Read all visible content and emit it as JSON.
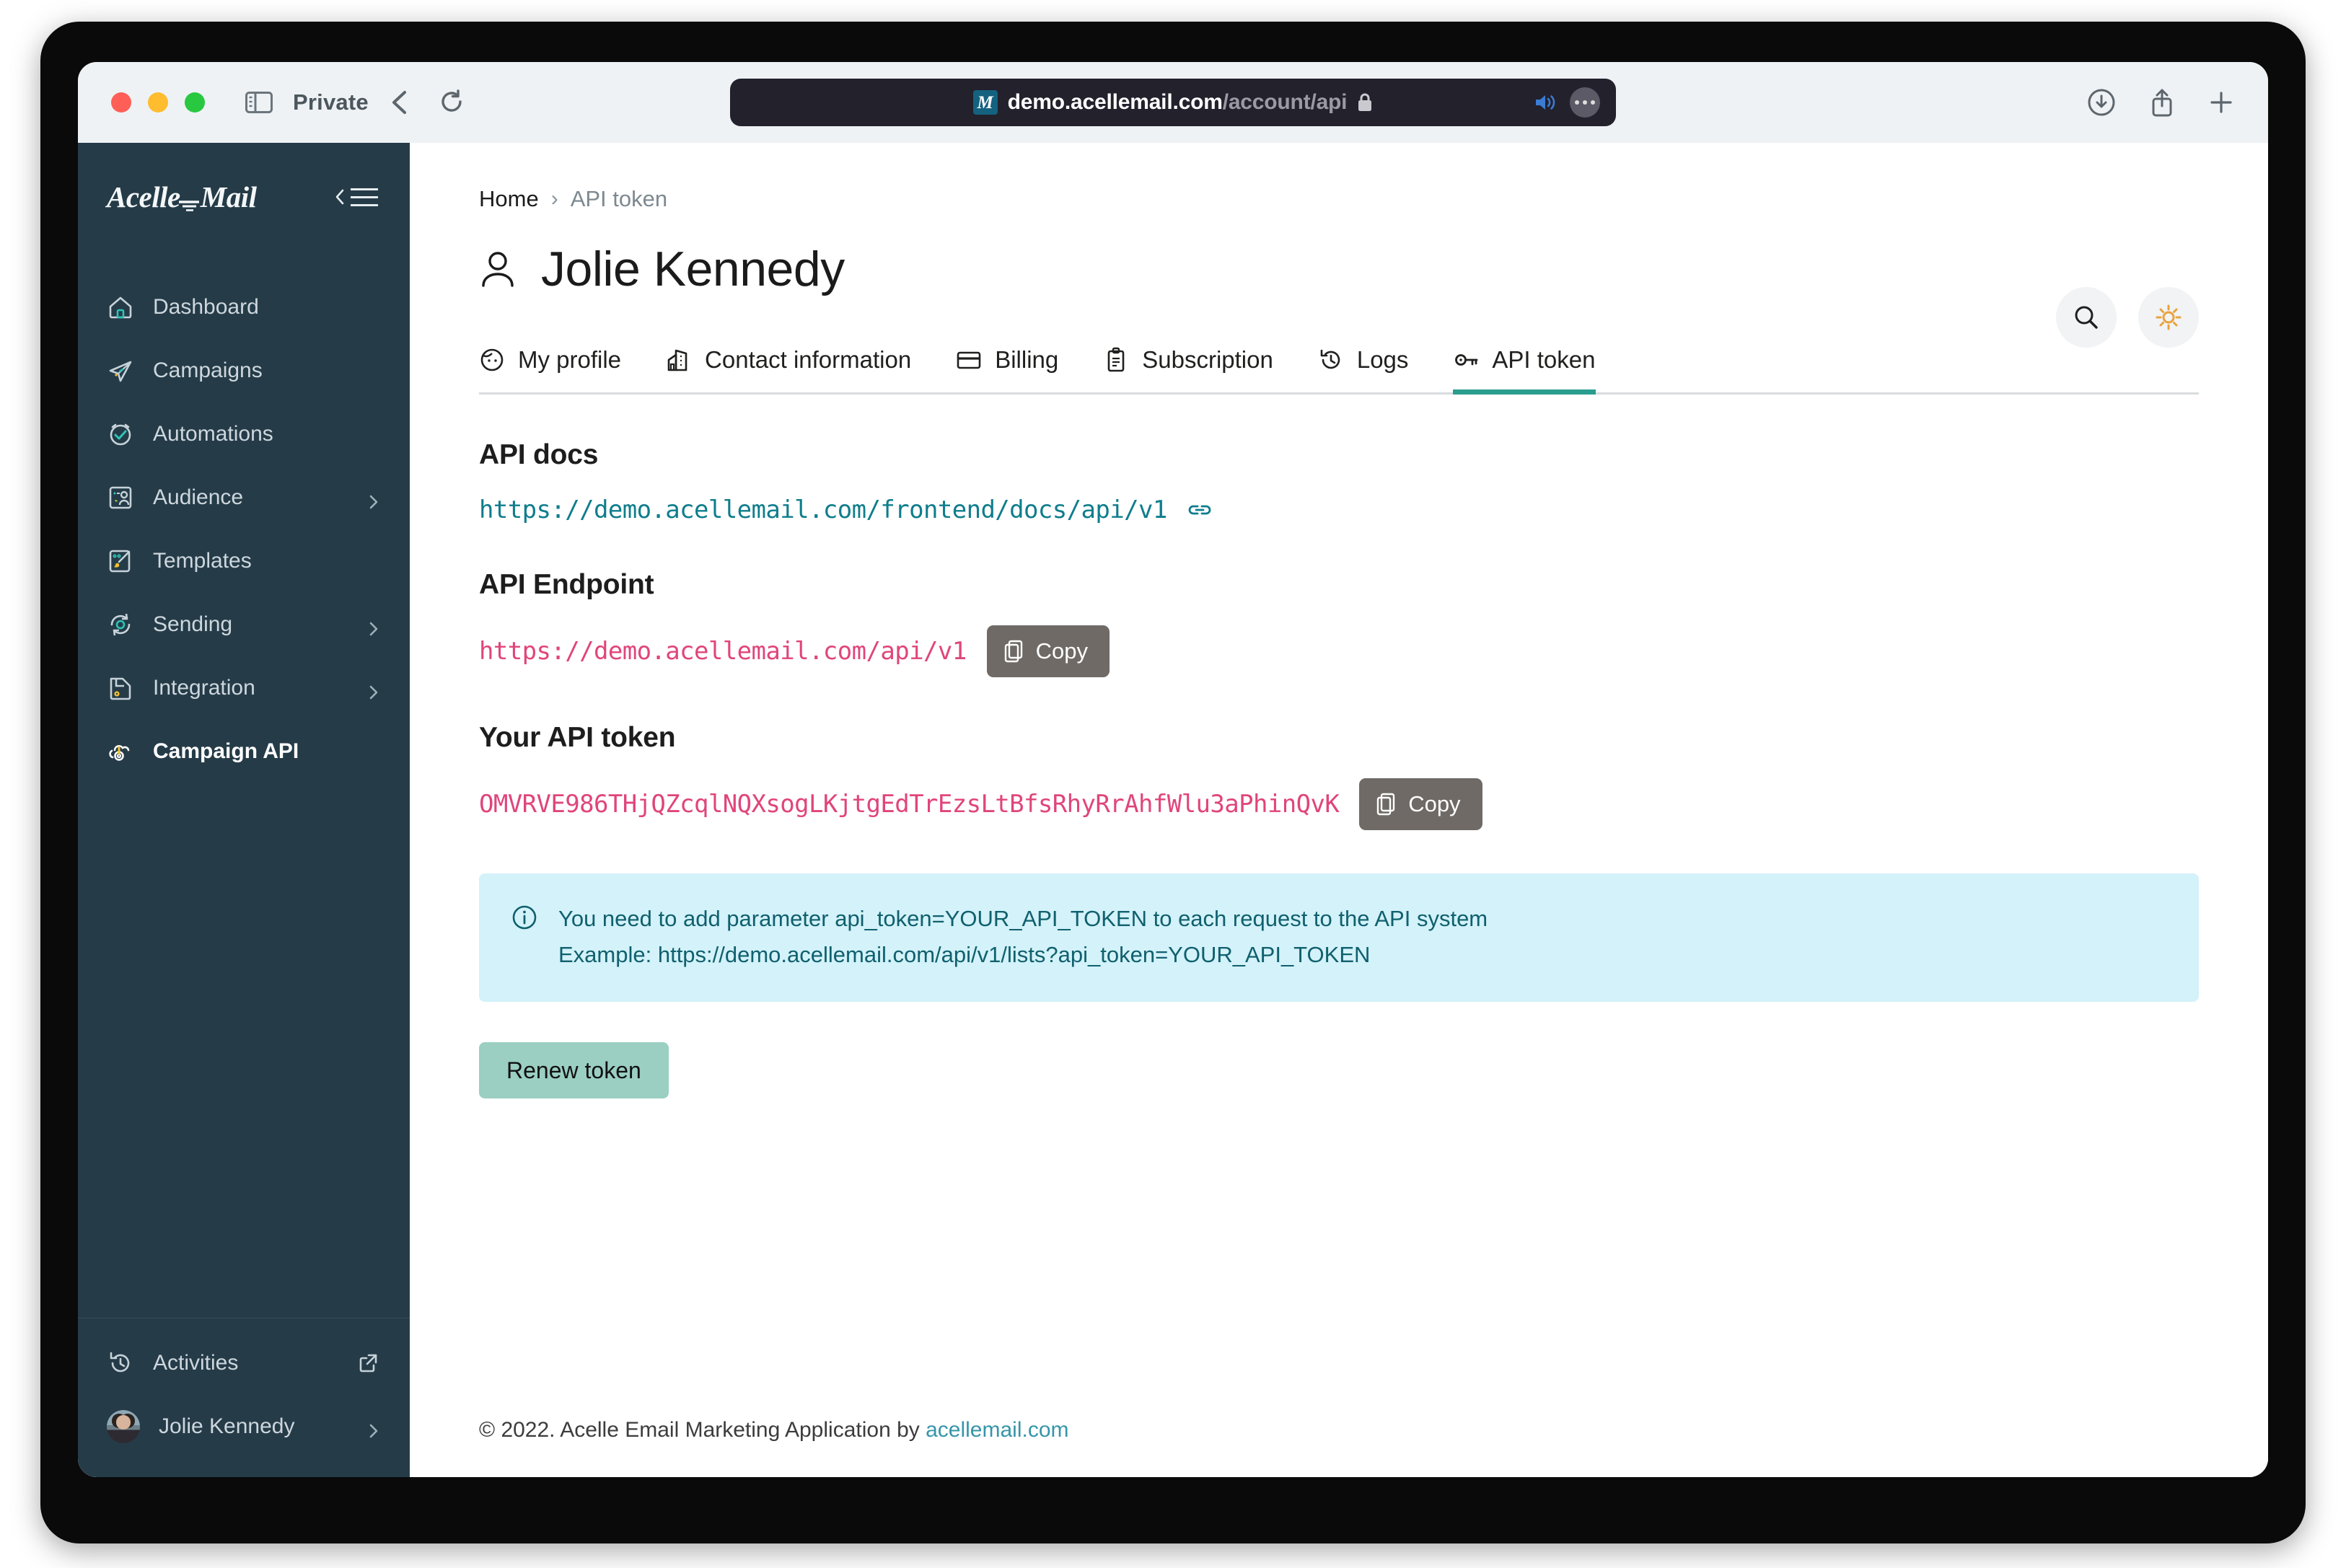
{
  "browser": {
    "private_label": "Private",
    "url_domain": "demo.acellemail.com",
    "url_path": "/account/api",
    "favicon_letter": "M"
  },
  "sidebar": {
    "brand_left": "Acelle",
    "brand_right": "Mail",
    "items": [
      {
        "label": "Dashboard",
        "icon": "home-icon",
        "chevron": false,
        "active": false
      },
      {
        "label": "Campaigns",
        "icon": "paper-plane-icon",
        "chevron": false,
        "active": false
      },
      {
        "label": "Automations",
        "icon": "check-circle-icon",
        "chevron": false,
        "active": false
      },
      {
        "label": "Audience",
        "icon": "contact-card-icon",
        "chevron": true,
        "active": false
      },
      {
        "label": "Templates",
        "icon": "brush-icon",
        "chevron": false,
        "active": false
      },
      {
        "label": "Sending",
        "icon": "sync-gear-icon",
        "chevron": true,
        "active": false
      },
      {
        "label": "Integration",
        "icon": "plug-save-icon",
        "chevron": true,
        "active": false
      },
      {
        "label": "Campaign API",
        "icon": "cloud-gear-icon",
        "chevron": false,
        "active": true
      }
    ],
    "bottom": {
      "activities_label": "Activities",
      "user_label": "Jolie Kennedy"
    }
  },
  "breadcrumb": {
    "home": "Home",
    "separator": "›",
    "current": "API token"
  },
  "header": {
    "title": "Jolie Kennedy"
  },
  "tabs": [
    {
      "label": "My profile",
      "icon": "face-icon",
      "active": false
    },
    {
      "label": "Contact information",
      "icon": "building-icon",
      "active": false
    },
    {
      "label": "Billing",
      "icon": "card-icon",
      "active": false
    },
    {
      "label": "Subscription",
      "icon": "clipboard-icon",
      "active": false
    },
    {
      "label": "Logs",
      "icon": "history-icon",
      "active": false
    },
    {
      "label": "API token",
      "icon": "key-icon",
      "active": true
    }
  ],
  "sections": {
    "api_docs": {
      "heading": "API docs",
      "url": "https://demo.acellemail.com/frontend/docs/api/v1"
    },
    "api_endpoint": {
      "heading": "API Endpoint",
      "url": "https://demo.acellemail.com/api/v1",
      "copy_label": "Copy"
    },
    "api_token": {
      "heading": "Your API token",
      "value": "OMVRVE986THjQZcqlNQXsogLKjtgEdTrEzsLtBfsRhyRrAhfWlu3aPhinQvK",
      "copy_label": "Copy"
    }
  },
  "alert": {
    "line1": "You need to add parameter api_token=YOUR_API_TOKEN to each request to the API system",
    "line2": "Example: https://demo.acellemail.com/api/v1/lists?api_token=YOUR_API_TOKEN"
  },
  "renew_button": {
    "label": "Renew token"
  },
  "footer": {
    "text": "© 2022. Acelle Email Marketing Application by ",
    "link": "acellemail.com"
  },
  "colors": {
    "sidebar_bg": "#253b48",
    "accent_teal": "#2a9d8f",
    "code_pink": "#e0457b",
    "link_teal": "#0f7d8c",
    "alert_bg": "#d3f2f9",
    "renew_bg": "#9acfc2"
  }
}
